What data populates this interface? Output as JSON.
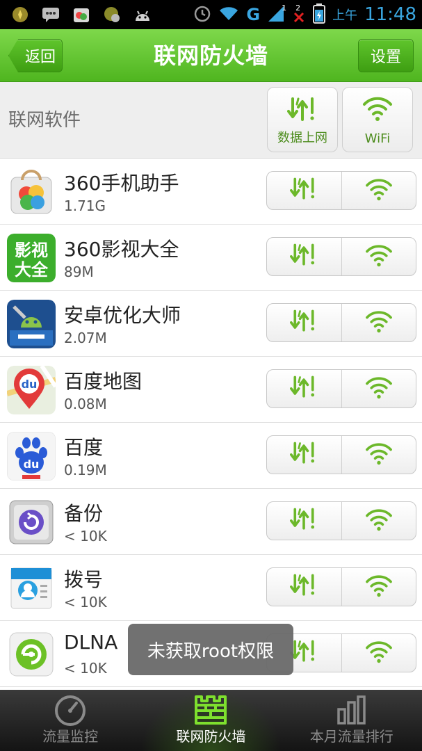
{
  "status_bar": {
    "network_type": "G",
    "sim_badge_1": "1",
    "sim_badge_2": "2",
    "ampm": "上午",
    "time": "11:48"
  },
  "title_bar": {
    "back_label": "返回",
    "title": "联网防火墙",
    "settings_label": "设置"
  },
  "header": {
    "label": "联网软件",
    "data_button": "数据上网",
    "wifi_button": "WiFi"
  },
  "apps": [
    {
      "name": "360手机助手",
      "size": "1.71G"
    },
    {
      "name": "360影视大全",
      "size": "89M"
    },
    {
      "name": "安卓优化大师",
      "size": "2.07M"
    },
    {
      "name": "百度地图",
      "size": "0.08M"
    },
    {
      "name": "百度",
      "size": "0.19M"
    },
    {
      "name": "备份",
      "size": "< 10K"
    },
    {
      "name": "拨号",
      "size": "< 10K"
    },
    {
      "name": "DLNA",
      "size": "< 10K"
    }
  ],
  "app_icon_text": {
    "video_line1": "影视",
    "video_line2": "大全",
    "map_badge": "du",
    "baidu_badge": "du"
  },
  "toast": "未获取root权限",
  "bottom_nav": [
    {
      "label": "流量监控",
      "active": false
    },
    {
      "label": "联网防火墙",
      "active": true
    },
    {
      "label": "本月流量排行",
      "active": false
    }
  ],
  "colors": {
    "accent_green": "#5cbf2a",
    "icon_green": "#6cb82a",
    "status_blue": "#3aa6e0"
  }
}
